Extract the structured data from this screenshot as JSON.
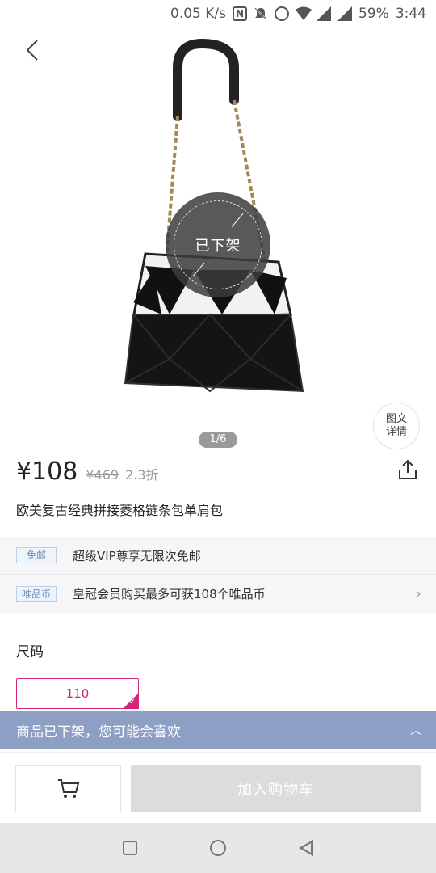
{
  "status_bar": {
    "speed": "0.05 K/s",
    "battery": "59%",
    "time": "3:44",
    "icons": [
      "nfc-icon",
      "mute-icon",
      "alarm-icon",
      "wifi-icon",
      "signal-icon",
      "signal-icon"
    ]
  },
  "hero": {
    "badge_text": "已下架",
    "detail_label_line1": "图文",
    "detail_label_line2": "详情",
    "pager": "1/6"
  },
  "product": {
    "price": "¥108",
    "original_price": "¥469",
    "discount": "2.3折",
    "title": "欧美复古经典拼接菱格链条包单肩包"
  },
  "promos": [
    {
      "tag": "免邮",
      "text": "超级VIP尊享无限次免邮"
    },
    {
      "tag": "唯品币",
      "text": "皇冠会员购买最多可获108个唯品币"
    }
  ],
  "size": {
    "title": "尺码",
    "selected": "110"
  },
  "recommend_bar": {
    "text": "商品已下架，您可能会喜欢"
  },
  "bottom": {
    "add_to_cart": "加入购物车"
  },
  "colors": {
    "accent": "#d3267a",
    "recommend_bg": "#8e9fc6",
    "disabled_btn": "#dcdcdc"
  }
}
